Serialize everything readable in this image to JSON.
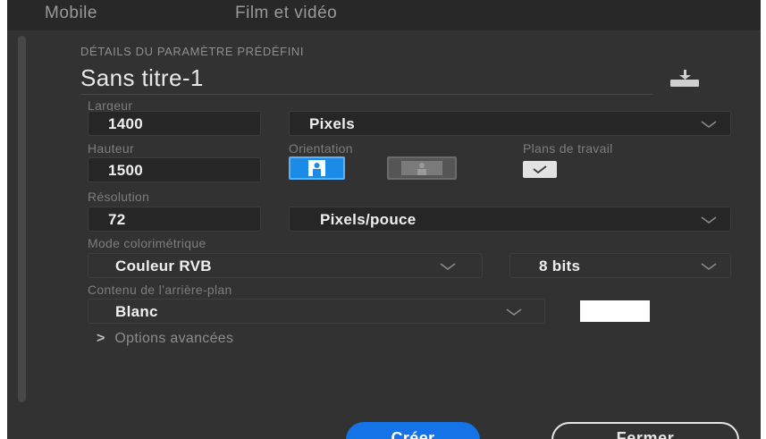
{
  "tabs": [
    "Mobile",
    "Film et vidéo"
  ],
  "preset": {
    "section_title": "DÉTAILS DU PARAMÈTRE PRÉDÉFINI",
    "document_name": "Sans titre-1"
  },
  "width": {
    "label": "Largeur",
    "value": "1400",
    "unit": "Pixels"
  },
  "height": {
    "label": "Hauteur",
    "value": "1500"
  },
  "orientation": {
    "label": "Orientation",
    "selected": "portrait"
  },
  "artboards": {
    "label": "Plans de travail",
    "checked": true
  },
  "resolution": {
    "label": "Résolution",
    "value": "72",
    "unit": "Pixels/pouce"
  },
  "color_mode": {
    "label": "Mode colorimétrique",
    "mode": "Couleur RVB",
    "depth": "8 bits"
  },
  "background": {
    "label": "Contenu de l’arrière-plan",
    "value": "Blanc",
    "swatch_color": "#ffffff"
  },
  "advanced": {
    "label": "Options avancées"
  },
  "actions": {
    "create": "Créer",
    "close": "Fermer"
  },
  "colors": {
    "accent": "#1473e6",
    "panel": "#323232"
  }
}
